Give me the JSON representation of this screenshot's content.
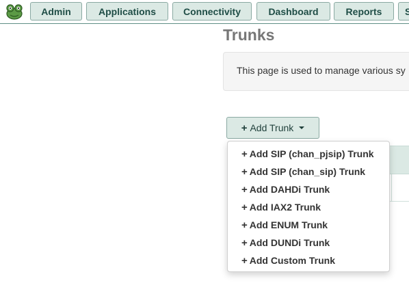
{
  "nav": {
    "logo_icon": "frog-logo-icon",
    "items": [
      "Admin",
      "Applications",
      "Connectivity",
      "Dashboard",
      "Reports",
      "S"
    ]
  },
  "page": {
    "title": "Trunks",
    "info_text": "This page is used to manage various sy"
  },
  "add_trunk": {
    "label": "Add Trunk",
    "icon": "plus-icon",
    "caret_icon": "caret-down-icon"
  },
  "dropdown": {
    "items": [
      "Add SIP (chan_pjsip) Trunk",
      "Add SIP (chan_sip) Trunk",
      "Add DAHDi Trunk",
      "Add IAX2 Trunk",
      "Add ENUM Trunk",
      "Add DUNDi Trunk",
      "Add Custom Trunk"
    ]
  },
  "colors": {
    "nav_bg": "#dbe9e4",
    "nav_text": "#1f4d46",
    "logo": "#6aa84f"
  }
}
